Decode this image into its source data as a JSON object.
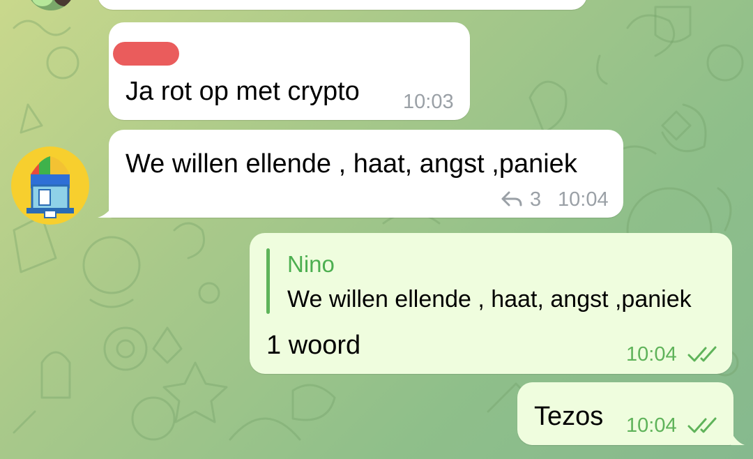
{
  "messages": [
    {
      "sender_redacted": true,
      "text": "Ja rot op met crypto",
      "time": "10:03"
    },
    {
      "text": "We willen ellende , haat, angst ,paniek",
      "replies_count": "3",
      "time": "10:04"
    },
    {
      "reply_to_name": "Nino",
      "reply_to_text": "We willen ellende , haat, angst ,paniek",
      "text": "1 woord",
      "time": "10:04",
      "status": "read"
    },
    {
      "text": "Tezos",
      "time": "10:04",
      "status": "read"
    }
  ],
  "icons": {
    "reply": "reply-arrow-icon",
    "read": "double-check-icon"
  },
  "colors": {
    "incoming_bubble": "#ffffff",
    "outgoing_bubble": "#effdde",
    "accent_green": "#4caf50",
    "redaction": "#ea5c5c"
  }
}
